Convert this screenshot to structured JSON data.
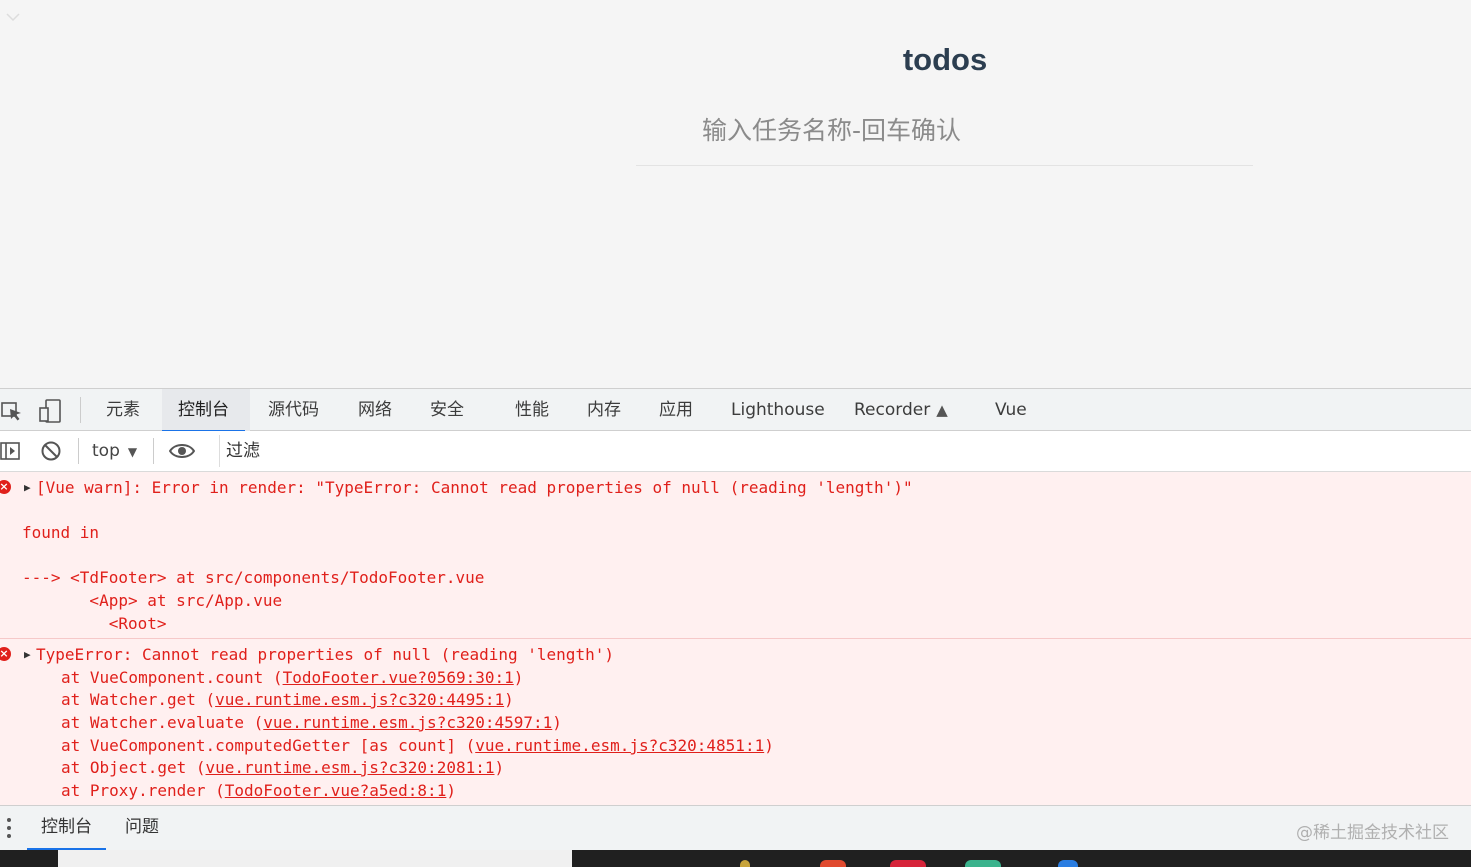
{
  "app": {
    "title": "todos",
    "new_todo_placeholder": "输入任务名称-回车确认"
  },
  "devtools": {
    "tabs": [
      {
        "label": "元素"
      },
      {
        "label": "控制台",
        "active": true
      },
      {
        "label": "源代码"
      },
      {
        "label": "网络"
      },
      {
        "label": "安全"
      },
      {
        "label": "性能"
      },
      {
        "label": "内存"
      },
      {
        "label": "应用"
      },
      {
        "label": "Lighthouse"
      },
      {
        "label": "Recorder"
      },
      {
        "label": "Vue"
      }
    ],
    "filter_bar": {
      "context": "top",
      "filter_placeholder": "过滤"
    },
    "console": {
      "messages": [
        {
          "level": "error",
          "lines": [
            "[Vue warn]: Error in render: \"TypeError: Cannot read properties of null (reading 'length')\"",
            "",
            "found in",
            "",
            "---> <TdFooter> at src/components/TodoFooter.vue",
            "       <App> at src/App.vue",
            "         <Root>"
          ]
        },
        {
          "level": "error",
          "header": "TypeError: Cannot read properties of null (reading 'length')",
          "stack": [
            {
              "at": "at VueComponent.count",
              "link": "TodoFooter.vue?0569:30:1"
            },
            {
              "at": "at Watcher.get",
              "link": "vue.runtime.esm.js?c320:4495:1"
            },
            {
              "at": "at Watcher.evaluate",
              "link": "vue.runtime.esm.js?c320:4597:1"
            },
            {
              "at": "at VueComponent.computedGetter [as count]",
              "link": "vue.runtime.esm.js?c320:4851:1"
            },
            {
              "at": "at Object.get",
              "link": "vue.runtime.esm.js?c320:2081:1"
            },
            {
              "at": "at Proxy.render",
              "link": "TodoFooter.vue?a5ed:8:1"
            }
          ]
        }
      ]
    },
    "drawer": {
      "tabs": [
        {
          "label": "控制台",
          "active": true
        },
        {
          "label": "问题"
        }
      ],
      "watermark": "@稀土掘金技术社区"
    }
  },
  "colors": {
    "accent": "#1a73e8",
    "error_text": "#e0201b",
    "error_bg": "#fff0f0",
    "title": "#2c3e50"
  },
  "icons": [
    "chevron-down-icon",
    "inspect-element-icon",
    "device-toolbar-icon",
    "flask-icon",
    "sidebar-toggle-icon",
    "clear-console-icon",
    "dropdown-arrow-icon",
    "eye-icon",
    "error-icon",
    "expand-triangle-icon",
    "kebab-menu-icon"
  ]
}
